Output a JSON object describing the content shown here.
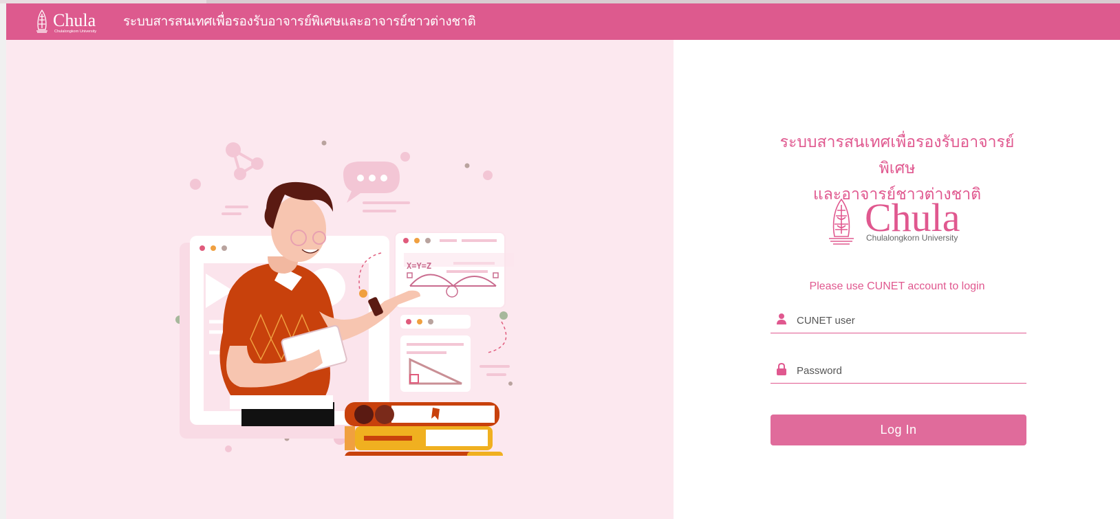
{
  "header": {
    "logo_text": "Chula",
    "logo_subtext": "Chulalongkorn University",
    "title": "ระบบสารสนเทศเพื่อรองรับอาจารย์พิเศษและอาจารย์ชาวต่างชาติ"
  },
  "login": {
    "title_line1": "ระบบสารสนเทศเพื่อรองรับอาจารย์พิเศษ",
    "title_line2": "และอาจารย์ชาวต่างชาติ",
    "logo_text": "Chula",
    "logo_subtext": "Chulalongkorn University",
    "hint": "Please use CUNET account to login",
    "username_placeholder": "CUNET user",
    "password_placeholder": "Password",
    "button_label": "Log In"
  },
  "illustration": {
    "equation": "X=Y=Z"
  },
  "colors": {
    "brand_pink": "#dd5a8e",
    "left_panel_bg": "#fce8ef",
    "accent_text": "#e0588f",
    "button": "#e06b9b"
  },
  "icons": {
    "user": "user-icon",
    "lock": "lock-icon",
    "emblem": "chula-emblem-icon"
  }
}
